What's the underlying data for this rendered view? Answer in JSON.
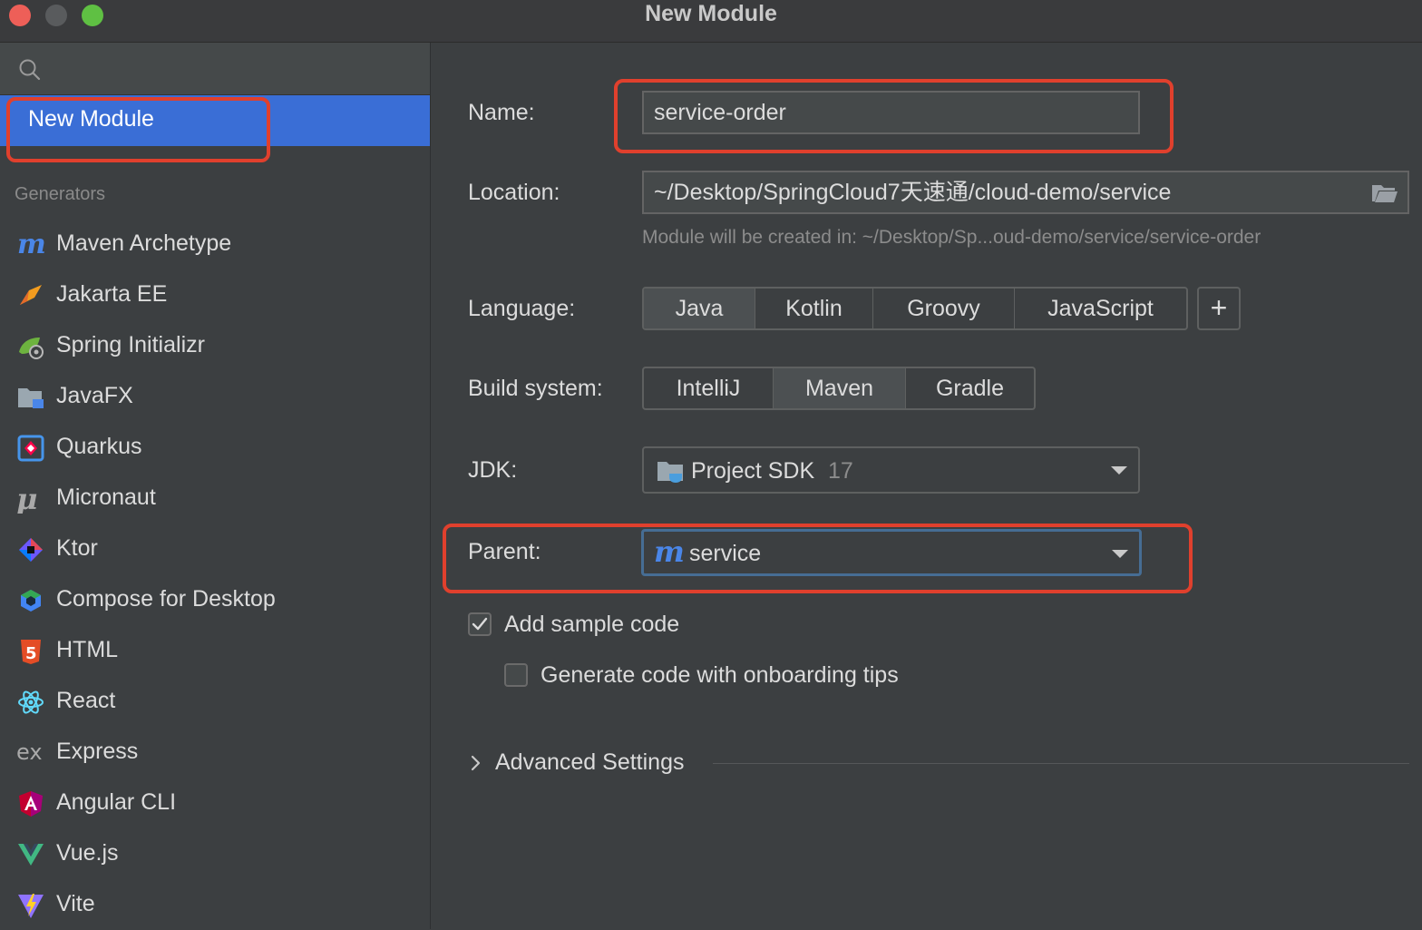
{
  "window": {
    "title": "New Module"
  },
  "sidebar": {
    "selected_label": "New Module",
    "section_label": "Generators",
    "generators": [
      {
        "label": "Maven Archetype",
        "icon": "maven-icon"
      },
      {
        "label": "Jakarta EE",
        "icon": "jakarta-ee-icon"
      },
      {
        "label": "Spring Initializr",
        "icon": "spring-icon"
      },
      {
        "label": "JavaFX",
        "icon": "javafx-folder-icon"
      },
      {
        "label": "Quarkus",
        "icon": "quarkus-icon"
      },
      {
        "label": "Micronaut",
        "icon": "micronaut-icon"
      },
      {
        "label": "Ktor",
        "icon": "ktor-icon"
      },
      {
        "label": "Compose for Desktop",
        "icon": "compose-icon"
      },
      {
        "label": "HTML",
        "icon": "html5-icon"
      },
      {
        "label": "React",
        "icon": "react-icon"
      },
      {
        "label": "Express",
        "icon": "express-icon"
      },
      {
        "label": "Angular CLI",
        "icon": "angular-icon"
      },
      {
        "label": "Vue.js",
        "icon": "vue-icon"
      },
      {
        "label": "Vite",
        "icon": "vite-icon"
      }
    ]
  },
  "form": {
    "name_label": "Name:",
    "name_value": "service-order",
    "location_label": "Location:",
    "location_value": "~/Desktop/SpringCloud7天速通/cloud-demo/service",
    "location_hint": "Module will be created in: ~/Desktop/Sp...oud-demo/service/service-order",
    "language_label": "Language:",
    "languages": [
      "Java",
      "Kotlin",
      "Groovy",
      "JavaScript"
    ],
    "language_selected": "Java",
    "add_language": "+",
    "build_label": "Build system:",
    "build_systems": [
      "IntelliJ",
      "Maven",
      "Gradle"
    ],
    "build_selected": "Maven",
    "jdk_label": "JDK:",
    "jdk_name": "Project SDK",
    "jdk_version": "17",
    "parent_label": "Parent:",
    "parent_value": "service",
    "sample_code_label": "Add sample code",
    "sample_code_checked": true,
    "onboarding_label": "Generate code with onboarding tips",
    "onboarding_checked": false,
    "advanced_label": "Advanced Settings"
  },
  "colors": {
    "accent": "#3a6ed6",
    "highlight_box": "#e0402d",
    "maven": "#4a86e8"
  }
}
